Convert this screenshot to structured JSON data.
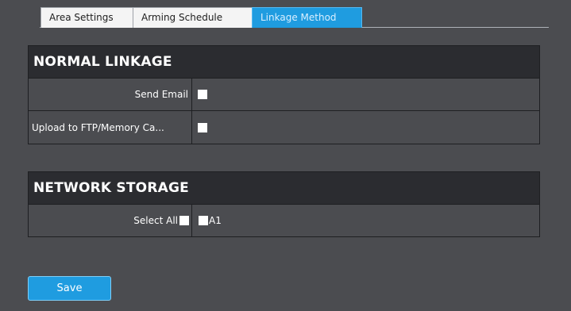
{
  "tabs": [
    {
      "label": "Area Settings",
      "active": false
    },
    {
      "label": "Arming Schedule",
      "active": false
    },
    {
      "label": "Linkage Method",
      "active": true
    }
  ],
  "normal_linkage": {
    "title": "NORMAL LINKAGE",
    "rows": [
      {
        "label": "Send Email",
        "checked": false
      },
      {
        "label": "Upload to FTP/Memory Ca...",
        "checked": false
      }
    ]
  },
  "network_storage": {
    "title": "NETWORK STORAGE",
    "select_all_label": "Select All",
    "select_all_checked": false,
    "channels": [
      {
        "label": "A1",
        "checked": false
      }
    ]
  },
  "save_label": "Save",
  "colors": {
    "background": "#4b4c50",
    "section_header": "#2b2c30",
    "accent": "#1f9ce0"
  }
}
